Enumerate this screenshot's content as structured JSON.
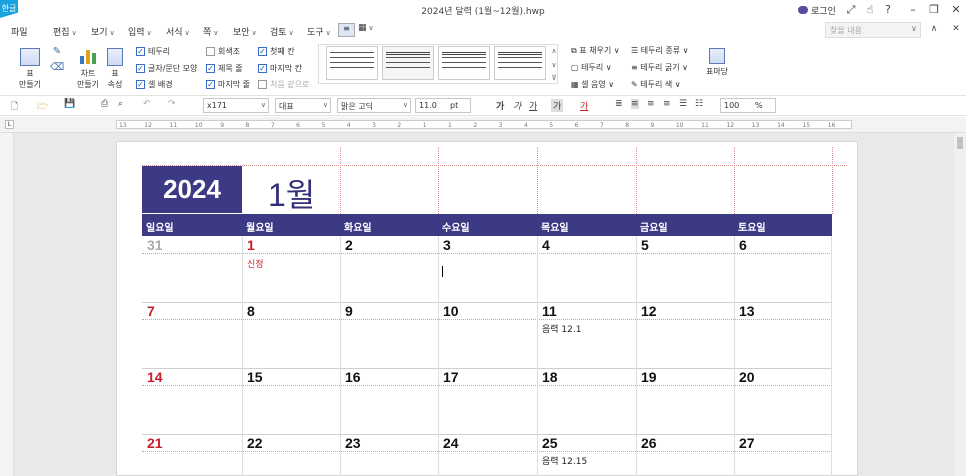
{
  "titlebar": {
    "app_badge": "한글",
    "title": "2024년 달력 (1월~12월).hwp",
    "login_label": "로그인",
    "icons": [
      "expand-icon",
      "hand-icon",
      "help-icon",
      "minimize-icon",
      "restore-icon",
      "close-icon"
    ]
  },
  "menubar": {
    "items": [
      "파일",
      "편집",
      "보기",
      "입력",
      "서식",
      "쪽",
      "보안",
      "검토",
      "도구"
    ],
    "search_placeholder": "찾을 내용"
  },
  "ribbon": {
    "table_label": "표\n만들기",
    "chart_label": "차트\n만들기",
    "table_props_label": "표\n속성",
    "checks": [
      {
        "label": "테두리",
        "checked": true
      },
      {
        "label": "글자/문단 모양",
        "checked": true
      },
      {
        "label": "셀 배경",
        "checked": true
      },
      {
        "label": "회색조",
        "checked": false
      },
      {
        "label": "제목 줄",
        "checked": true
      },
      {
        "label": "마지막 줄",
        "checked": true
      },
      {
        "label": "첫째 칸",
        "checked": true
      },
      {
        "label": "마지막 칸",
        "checked": true
      },
      {
        "label": "처음 같으로",
        "checked": false
      }
    ],
    "right_items": [
      "표 채우기",
      "테두리",
      "셀 음영",
      "테두리 종류",
      "테두리 굵기",
      "테두리 색"
    ],
    "table_macro_label": "표마당"
  },
  "toolbar2": {
    "style_value": "x171",
    "para_value": "대표",
    "font_value": "맑은 고딕",
    "size_value": "11.0",
    "size_unit": "pt",
    "zoom_value": "100",
    "zoom_unit": "%",
    "format_glyphs": [
      "가",
      "가",
      "가",
      "가",
      "가"
    ]
  },
  "ruler": {
    "ticks": [
      "13",
      "12",
      "11",
      "10",
      "9",
      "8",
      "7",
      "6",
      "5",
      "4",
      "3",
      "2",
      "1",
      "1",
      "2",
      "3",
      "4",
      "5",
      "6",
      "7",
      "8",
      "9",
      "10",
      "11",
      "12",
      "13",
      "14",
      "15",
      "16"
    ]
  },
  "calendar": {
    "year": "2024",
    "month": "1월",
    "weekdays": [
      "일요일",
      "월요일",
      "화요일",
      "수요일",
      "목요일",
      "금요일",
      "토요일"
    ],
    "weeks": [
      [
        {
          "d": "31",
          "c": "gray"
        },
        {
          "d": "1",
          "c": "red",
          "note": "신정",
          "nc": "red"
        },
        {
          "d": "2"
        },
        {
          "d": "3"
        },
        {
          "d": "4"
        },
        {
          "d": "5"
        },
        {
          "d": "6"
        }
      ],
      [
        {
          "d": "7",
          "c": "red"
        },
        {
          "d": "8"
        },
        {
          "d": "9"
        },
        {
          "d": "10"
        },
        {
          "d": "11",
          "note": "음력  12.1"
        },
        {
          "d": "12"
        },
        {
          "d": "13"
        }
      ],
      [
        {
          "d": "14",
          "c": "red"
        },
        {
          "d": "15"
        },
        {
          "d": "16"
        },
        {
          "d": "17"
        },
        {
          "d": "18"
        },
        {
          "d": "19"
        },
        {
          "d": "20"
        }
      ],
      [
        {
          "d": "21",
          "c": "red"
        },
        {
          "d": "22"
        },
        {
          "d": "23"
        },
        {
          "d": "24"
        },
        {
          "d": "25",
          "note": "음력  12.15"
        },
        {
          "d": "26"
        },
        {
          "d": "27"
        }
      ]
    ]
  }
}
